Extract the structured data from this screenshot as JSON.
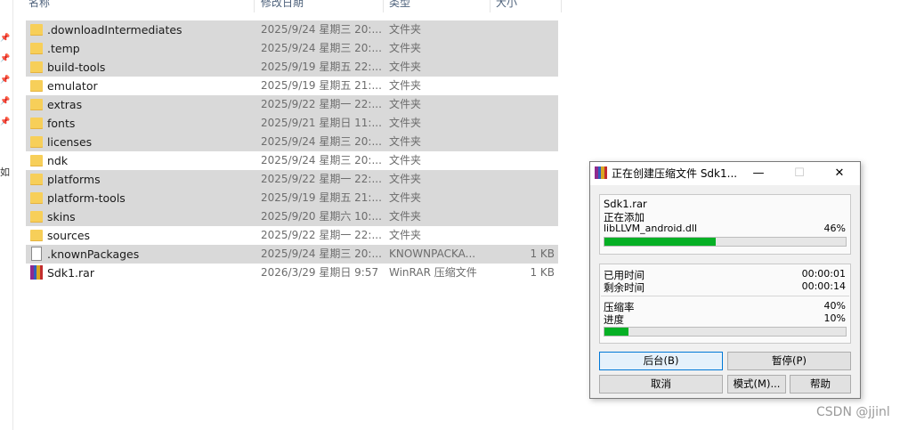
{
  "explorer": {
    "columns": {
      "name": "名称",
      "date_modified": "修改日期",
      "type": "类型",
      "size": "大小"
    },
    "nav_cut_text": "如",
    "rows": [
      {
        "name": ".downloadIntermediates",
        "date": "2025/9/24 星期三 20:...",
        "type": "文件夹",
        "size": "",
        "icon": "folder-icon",
        "selected": true
      },
      {
        "name": ".temp",
        "date": "2025/9/24 星期三 20:...",
        "type": "文件夹",
        "size": "",
        "icon": "folder-icon",
        "selected": true
      },
      {
        "name": "build-tools",
        "date": "2025/9/19 星期五 22:...",
        "type": "文件夹",
        "size": "",
        "icon": "folder-icon",
        "selected": true
      },
      {
        "name": "emulator",
        "date": "2025/9/19 星期五 21:...",
        "type": "文件夹",
        "size": "",
        "icon": "folder-icon",
        "selected": false
      },
      {
        "name": "extras",
        "date": "2025/9/22 星期一 22:...",
        "type": "文件夹",
        "size": "",
        "icon": "folder-icon",
        "selected": true
      },
      {
        "name": "fonts",
        "date": "2025/9/21 星期日 11:...",
        "type": "文件夹",
        "size": "",
        "icon": "folder-icon",
        "selected": true
      },
      {
        "name": "licenses",
        "date": "2025/9/24 星期三 20:...",
        "type": "文件夹",
        "size": "",
        "icon": "folder-icon",
        "selected": true
      },
      {
        "name": "ndk",
        "date": "2025/9/24 星期三 20:...",
        "type": "文件夹",
        "size": "",
        "icon": "folder-icon",
        "selected": false
      },
      {
        "name": "platforms",
        "date": "2025/9/22 星期一 22:...",
        "type": "文件夹",
        "size": "",
        "icon": "folder-icon",
        "selected": true
      },
      {
        "name": "platform-tools",
        "date": "2025/9/19 星期五 21:...",
        "type": "文件夹",
        "size": "",
        "icon": "folder-icon",
        "selected": true
      },
      {
        "name": "skins",
        "date": "2025/9/20 星期六 10:...",
        "type": "文件夹",
        "size": "",
        "icon": "folder-icon",
        "selected": true
      },
      {
        "name": "sources",
        "date": "2025/9/22 星期一 22:...",
        "type": "文件夹",
        "size": "",
        "icon": "folder-icon",
        "selected": false
      },
      {
        "name": ".knownPackages",
        "date": "2025/9/24 星期三 20:...",
        "type": "KNOWNPACKA...",
        "size": "1 KB",
        "icon": "file-icon",
        "selected": true
      },
      {
        "name": "Sdk1.rar",
        "date": "2026/3/29 星期日 9:57",
        "type": "WinRAR 压缩文件",
        "size": "1 KB",
        "icon": "winrar-archive-icon",
        "selected": false
      }
    ]
  },
  "dialog": {
    "title": "正在创建压缩文件 Sdk1...",
    "archive_name": "Sdk1.rar",
    "action": "正在添加",
    "current_file": "libLLVM_android.dll",
    "file_percent_text": "46%",
    "file_progress": 0.46,
    "elapsed_label": "已用时间",
    "elapsed_value": "00:00:01",
    "remaining_label": "剩余时间",
    "remaining_value": "00:00:14",
    "ratio_label": "压缩率",
    "ratio_value": "40%",
    "progress_label": "进度",
    "progress_value": "10%",
    "total_progress": 0.1,
    "buttons": {
      "background": "后台(B)",
      "pause": "暂停(P)",
      "cancel": "取消",
      "mode": "模式(M)...",
      "help": "帮助"
    },
    "close_glyph": "✕",
    "min_glyph": "—",
    "max_glyph": "☐"
  },
  "watermark": "CSDN @jjinl",
  "colors": {
    "selection": "#d9d9d9",
    "progress_fill": "#06b025",
    "folder": "#f7cf59"
  }
}
